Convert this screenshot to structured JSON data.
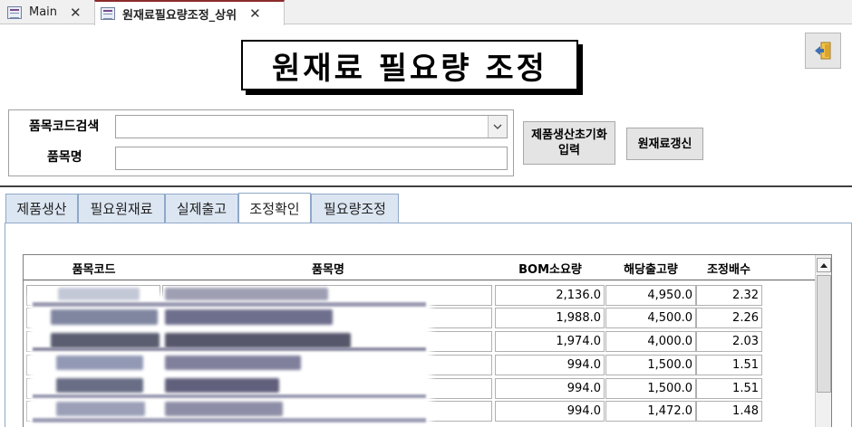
{
  "tabs": {
    "main_label": "Main",
    "active_label": "원재료필요량조정_상위",
    "close_glyph": "✕"
  },
  "form": {
    "title": "원재료 필요량 조정",
    "code_search_label": "품목코드검색",
    "name_label": "품목명",
    "code_value": "",
    "name_value": "",
    "init_button_label": "제품생산초기화 입력",
    "init_button_line1": "제품생산초기화",
    "init_button_line2": "입력",
    "refresh_button_label": "원재료갱신",
    "exit_icon": "exit-door-icon"
  },
  "form_tabs": [
    {
      "label": "제품생산",
      "active": false
    },
    {
      "label": "필요원재료",
      "active": false
    },
    {
      "label": "실제출고",
      "active": false
    },
    {
      "label": "조정확인",
      "active": true
    },
    {
      "label": "필요량조정",
      "active": false
    }
  ],
  "grid": {
    "columns": [
      "품목코드",
      "품목명",
      "BOM소요량",
      "해당출고량",
      "조정배수"
    ],
    "rows": [
      {
        "bom": "2,136.0",
        "out": "4,950.0",
        "factor": "2.32"
      },
      {
        "bom": "1,988.0",
        "out": "4,500.0",
        "factor": "2.26"
      },
      {
        "bom": "1,974.0",
        "out": "4,000.0",
        "factor": "2.03"
      },
      {
        "bom": "994.0",
        "out": "1,500.0",
        "factor": "1.51"
      },
      {
        "bom": "994.0",
        "out": "1,500.0",
        "factor": "1.51"
      },
      {
        "bom": "994.0",
        "out": "1,472.0",
        "factor": "1.48"
      }
    ]
  },
  "colors": {
    "active_tab_accent": "#8b2a2a",
    "tab_background": "#dce6f2",
    "tab_border": "#8fa8c8"
  }
}
